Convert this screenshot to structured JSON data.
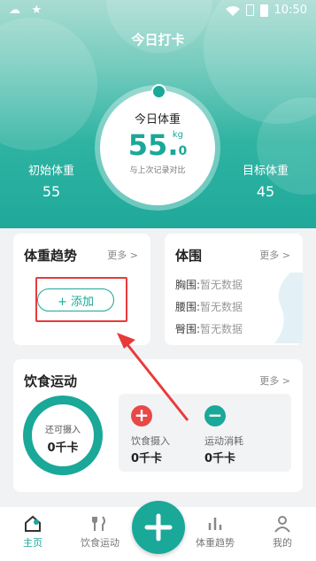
{
  "status_bar": {
    "left_glyphs": "☁ ★",
    "time": "10:50"
  },
  "header": {
    "title": "今日打卡",
    "today_label": "今日体重",
    "weight_int": "55.",
    "weight_dec": "0",
    "unit": "kg",
    "compare_text": "与上次记录对比",
    "initial_label": "初始体重",
    "initial_value": "55",
    "target_label": "目标体重",
    "target_value": "45"
  },
  "trend_card": {
    "title": "体重趋势",
    "more": "更多 >",
    "add_label": "+ 添加"
  },
  "girth_card": {
    "title": "体围",
    "more": "更多 >",
    "rows": [
      {
        "label": "胸围:",
        "value": "暂无数据"
      },
      {
        "label": "腰围:",
        "value": "暂无数据"
      },
      {
        "label": "臀围:",
        "value": "暂无数据"
      }
    ]
  },
  "diet_card": {
    "title": "饮食运动",
    "more": "更多 >",
    "remain_label": "还可摄入",
    "remain_value": "0千卡",
    "intake_label": "饮食摄入",
    "intake_value": "0千卡",
    "burn_label": "运动消耗",
    "burn_value": "0千卡"
  },
  "tabs": [
    {
      "label": "主页",
      "icon": "home-icon",
      "active": true
    },
    {
      "label": "饮食运动",
      "icon": "fork-knife-icon",
      "active": false
    },
    {
      "label": "体重趋势",
      "icon": "bar-chart-icon",
      "active": false
    },
    {
      "label": "我的",
      "icon": "user-icon",
      "active": false
    }
  ],
  "colors": {
    "accent": "#1aa898",
    "highlight": "#e83a3a"
  }
}
